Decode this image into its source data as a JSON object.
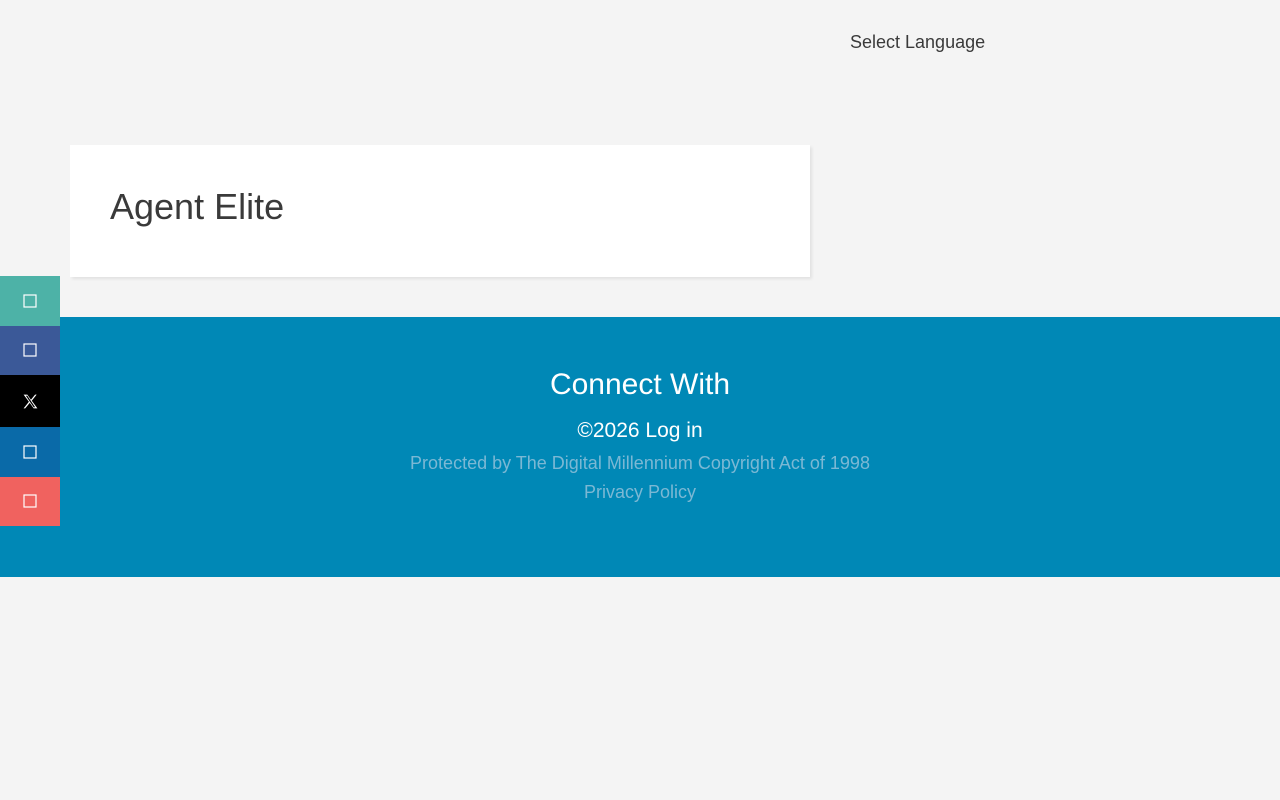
{
  "header": {
    "language_select_label": "Select Language"
  },
  "card": {
    "title": "Agent Elite"
  },
  "social": {
    "items": [
      {
        "name": "share",
        "color": "#4db2a7"
      },
      {
        "name": "facebook",
        "color": "#3b5998"
      },
      {
        "name": "x",
        "color": "#000000"
      },
      {
        "name": "linkedin",
        "color": "#0a6aa8"
      },
      {
        "name": "email",
        "color": "#f0625f"
      }
    ]
  },
  "footer": {
    "heading": "Connect With",
    "copyright": "©2026",
    "login_link": "Log in",
    "dmca_text": "Protected by The Digital Millennium Copyright Act of 1998",
    "privacy_link": "Privacy Policy",
    "background_color": "#0088b6"
  }
}
